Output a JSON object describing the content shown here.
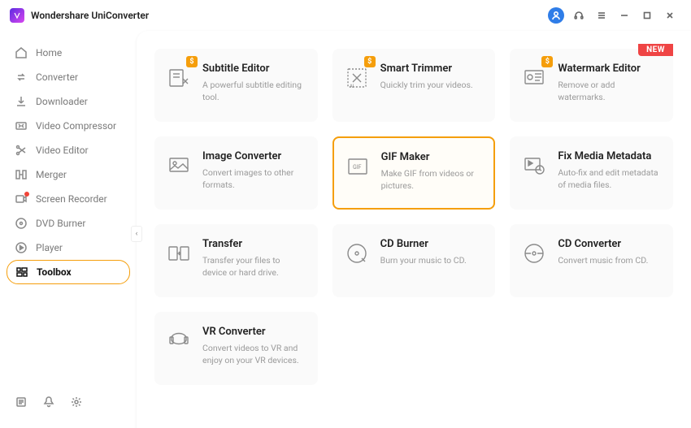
{
  "app": {
    "title": "Wondershare UniConverter"
  },
  "sidebar": {
    "items": [
      {
        "label": "Home"
      },
      {
        "label": "Converter"
      },
      {
        "label": "Downloader"
      },
      {
        "label": "Video Compressor"
      },
      {
        "label": "Video Editor"
      },
      {
        "label": "Merger"
      },
      {
        "label": "Screen Recorder"
      },
      {
        "label": "DVD Burner"
      },
      {
        "label": "Player"
      },
      {
        "label": "Toolbox"
      }
    ],
    "active_index": 9
  },
  "toolbox": {
    "cards": [
      {
        "title": "Subtitle Editor",
        "desc": "A powerful subtitle editing tool.",
        "paid": true
      },
      {
        "title": "Smart Trimmer",
        "desc": "Quickly trim your videos.",
        "paid": true
      },
      {
        "title": "Watermark Editor",
        "desc": "Remove or add watermarks.",
        "paid": true,
        "new": true
      },
      {
        "title": "Image Converter",
        "desc": "Convert images to other formats."
      },
      {
        "title": "GIF Maker",
        "desc": "Make GIF from videos or pictures.",
        "selected": true
      },
      {
        "title": "Fix Media Metadata",
        "desc": "Auto-fix and edit metadata of media files."
      },
      {
        "title": "Transfer",
        "desc": "Transfer your files to device or hard drive."
      },
      {
        "title": "CD Burner",
        "desc": "Burn your music to CD."
      },
      {
        "title": "CD Converter",
        "desc": "Convert music from CD."
      },
      {
        "title": "VR Converter",
        "desc": "Convert videos to VR and enjoy on your VR devices."
      }
    ]
  },
  "badges": {
    "new": "NEW",
    "paid": "$"
  }
}
